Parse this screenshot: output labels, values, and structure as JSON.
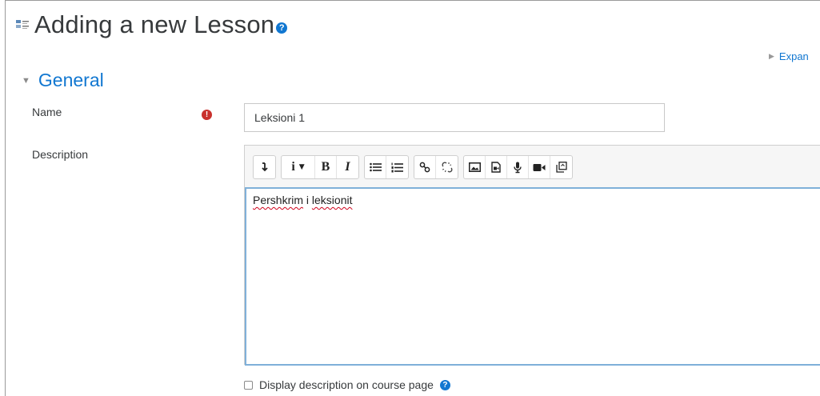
{
  "page": {
    "title": "Adding a new Lesson",
    "title_help": "?",
    "expand_all": "Expan"
  },
  "section": {
    "legend": "General"
  },
  "form": {
    "name_label": "Name",
    "name_value": "Leksioni 1",
    "required_icon": "!",
    "description_label": "Description",
    "description_text": [
      "Pershkrim",
      " i ",
      "leksionit"
    ],
    "display_checkbox_label": "Display description on course page",
    "display_checkbox_checked": false,
    "display_help": "?"
  },
  "toolbar": {
    "groups": [
      [
        "toolbar-toggle-icon"
      ],
      [
        "paragraph-styles-icon",
        "bold-icon",
        "italic-icon"
      ],
      [
        "unordered-list-icon",
        "ordered-list-icon"
      ],
      [
        "link-icon",
        "unlink-icon"
      ],
      [
        "image-icon",
        "media-icon",
        "record-audio-icon",
        "record-video-icon",
        "manage-files-icon"
      ]
    ],
    "bold_label": "B",
    "italic_label": "I",
    "styles_label": "i"
  },
  "colors": {
    "accent": "#1177d1",
    "required": "#c9302c",
    "editor_focus_border": "#7fb0d9"
  }
}
